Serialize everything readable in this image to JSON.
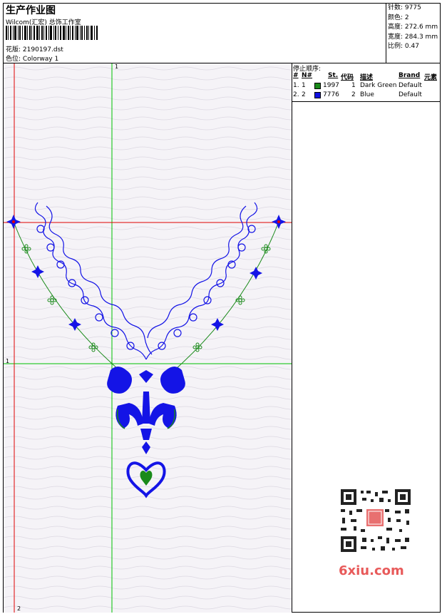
{
  "header": {
    "title": "生产作业图",
    "company": "Wilcom(汇宏) 总饰工作室",
    "design_label": "花版:",
    "design_value": "2190197.dst",
    "colorway_label": "色位:",
    "colorway_value": "Colorway 1"
  },
  "stats": [
    {
      "label": "针数:",
      "value": "9775"
    },
    {
      "label": "颜色:",
      "value": "2"
    },
    {
      "label": "高度:",
      "value": "272.6 mm"
    },
    {
      "label": "宽度:",
      "value": "284.3 mm"
    },
    {
      "label": "比例:",
      "value": "0.47"
    }
  ],
  "stop_sequence": {
    "title": "停止顺序:",
    "columns": [
      "#",
      "N#",
      "St.",
      "代码",
      "描述",
      "Brand",
      "元素"
    ],
    "rows": [
      {
        "num": "1.",
        "n": "1",
        "stitches": "1997",
        "code": "1",
        "desc": "Dark Green",
        "brand": "Default",
        "color": "#1a8a1a"
      },
      {
        "num": "2.",
        "n": "2",
        "stitches": "7776",
        "code": "2",
        "desc": "Blue",
        "brand": "Default",
        "color": "#1010e0"
      }
    ]
  },
  "canvas": {
    "axis_labels": {
      "top_x": "1",
      "left_y": "1",
      "bottom": "2"
    }
  },
  "watermark": {
    "text": "6xiu.com"
  },
  "colors": {
    "green": "#1a8a1a",
    "blue": "#1414e6",
    "red": "#e00000",
    "guide": "#00c000"
  }
}
